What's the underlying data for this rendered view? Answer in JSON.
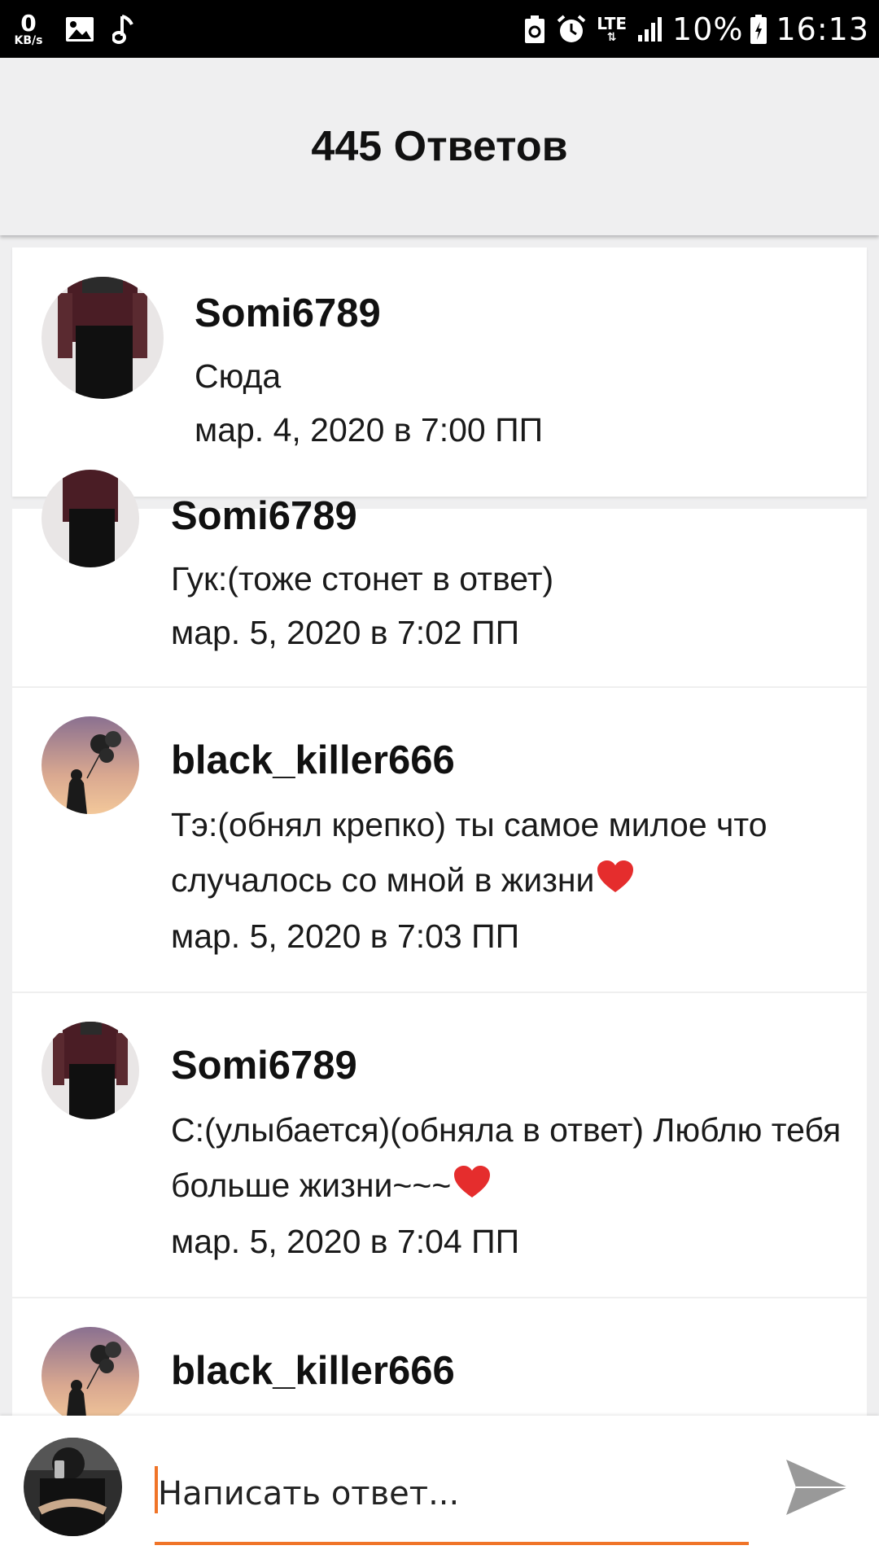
{
  "status_bar": {
    "net_speed": "0",
    "net_unit": "KB/s",
    "network": "LTE",
    "battery": "10%",
    "time": "16:13"
  },
  "header": {
    "title": "445 Ответов"
  },
  "replies": [
    {
      "username": "Somi6789",
      "text": "Сюда",
      "date": "мар. 4, 2020 в 7:00 ПП"
    },
    {
      "username": "Somi6789",
      "text": "Гук:(тоже стонет в ответ)",
      "date": "мар. 5, 2020 в 7:02 ПП"
    },
    {
      "username": "black_killer666",
      "text": "Тэ:(обнял крепко) ты самое милое что случалось со мной в жизни",
      "date": "мар. 5, 2020 в 7:03 ПП"
    },
    {
      "username": "Somi6789",
      "text": "С:(улыбается)(обняла в ответ) Люблю тебя больше жизни~~~",
      "date": "мар. 5, 2020 в 7:04 ПП"
    },
    {
      "username": "black_killer666"
    }
  ],
  "composer": {
    "placeholder": "Написать ответ..."
  },
  "icons": {
    "heart": "heart-icon",
    "send": "send-icon"
  },
  "colors": {
    "accent": "#f07428",
    "heart": "#e52d2d",
    "background": "#efeff0"
  }
}
